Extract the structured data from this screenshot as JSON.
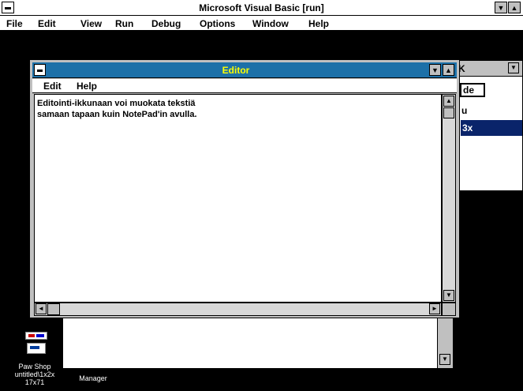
{
  "app": {
    "title": "Microsoft Visual Basic [run]",
    "menu": [
      "File",
      "Edit",
      "View",
      "Run",
      "Debug",
      "Options",
      "Window",
      "Help"
    ]
  },
  "editor": {
    "title": "Editor",
    "menu": [
      "Edit",
      "Help"
    ],
    "text_lines": [
      "Editointi-ikkunaan voi muokata tekstiä",
      "samaan tapaan kuin NotePad'in avulla."
    ]
  },
  "side_window": {
    "top_label": "K",
    "items": [
      "de",
      "u",
      "3x"
    ]
  },
  "desktop_icons": [
    {
      "label": "Paw Shop\nuntitled\\1x2x\n17x71",
      "icon": "program-icon"
    },
    {
      "label": "Manager",
      "icon": "manager-icon"
    }
  ],
  "colors": {
    "editor_title_bg": "#1c70a8",
    "editor_title_fg": "#ffff00",
    "highlight": "#0a246a"
  }
}
